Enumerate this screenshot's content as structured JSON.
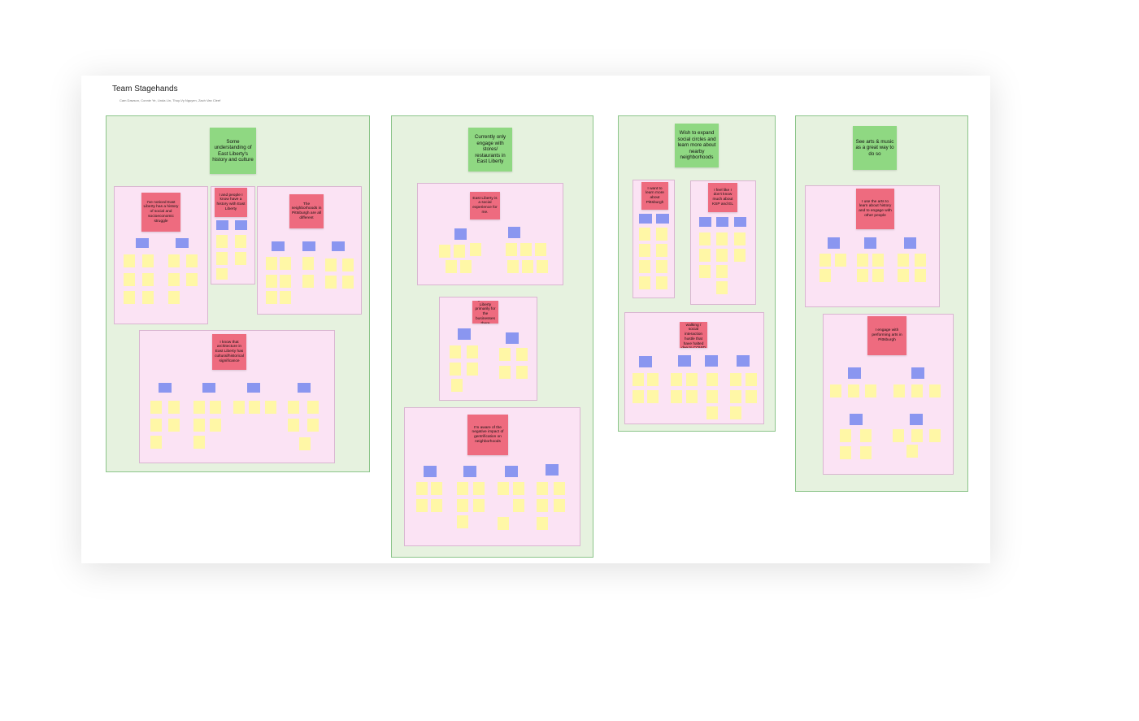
{
  "board": {
    "title": "Team Stagehands",
    "members": "Cam Dawson, Connie Ye, Linda Lin, Thuy-Vy Nguyen, Zach Van Cleef"
  },
  "themes": [
    {
      "id": "t1",
      "heading": "Some understanding of East Liberty's history and culture",
      "clusters": [
        {
          "id": "c1",
          "insight": "I've noticed East Liberty has a history of social and socioeconomic struggle"
        },
        {
          "id": "c2",
          "insight": "I and people I know have a history with East Liberty"
        },
        {
          "id": "c3",
          "insight": "The neighborhoods in Pittsburgh are all different"
        },
        {
          "id": "c4",
          "insight": "I know that architecture in East Liberty has cultural/historical significance"
        }
      ]
    },
    {
      "id": "t2",
      "heading": "Currently only engage with stores/ restaurants in East Liberty",
      "clusters": [
        {
          "id": "c5",
          "insight": "East Liberty is a social experience for me."
        },
        {
          "id": "c6",
          "insight": "I go to East Liberty primarily for the businesses there"
        },
        {
          "id": "c7",
          "insight": "I'm aware of the negative impact of gentrification on neighborhoods"
        }
      ]
    },
    {
      "id": "t3",
      "heading": "Wish to expand social circles and learn more about nearby neighborhoods",
      "clusters": [
        {
          "id": "c8",
          "insight": "I want to learn more about Pittsburgh"
        },
        {
          "id": "c9",
          "insight": "I feel like I don't know much about KSP and EL"
        },
        {
          "id": "c10",
          "insight": "I miss daily walking / social interaction hustle that have halted due to COVID"
        }
      ]
    },
    {
      "id": "t4",
      "heading": "See arts & music as a great way to do so",
      "clusters": [
        {
          "id": "c11",
          "insight": "I use the arts to learn about history and to engage with other people"
        },
        {
          "id": "c12",
          "insight": "I engage with performing arts in Pittsburgh"
        }
      ]
    }
  ],
  "colors": {
    "theme_bg": "#e6f2df",
    "cluster_bg": "#fbe3f4",
    "green_sticky": "#8fd882",
    "red_sticky": "#ee6b7f",
    "blue_sticky": "#8a96f0",
    "yellow_sticky": "#fff7a6"
  }
}
